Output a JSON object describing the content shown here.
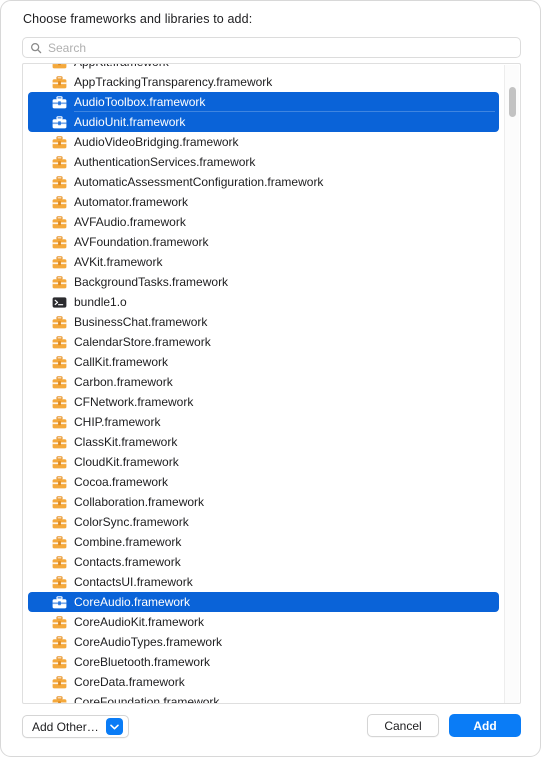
{
  "dialog": {
    "prompt": "Choose frameworks and libraries to add:"
  },
  "search": {
    "icon": "search-icon",
    "placeholder": "Search",
    "value": ""
  },
  "list": {
    "scrollbar": {
      "visible": true
    },
    "items": [
      {
        "label": "AppKit.framework",
        "icon": "framework-icon",
        "selected": false,
        "clipped": true
      },
      {
        "label": "AppTrackingTransparency.framework",
        "icon": "framework-icon",
        "selected": false
      },
      {
        "label": "AudioToolbox.framework",
        "icon": "framework-icon",
        "selected": true
      },
      {
        "label": "AudioUnit.framework",
        "icon": "framework-icon",
        "selected": true
      },
      {
        "label": "AudioVideoBridging.framework",
        "icon": "framework-icon",
        "selected": false
      },
      {
        "label": "AuthenticationServices.framework",
        "icon": "framework-icon",
        "selected": false
      },
      {
        "label": "AutomaticAssessmentConfiguration.framework",
        "icon": "framework-icon",
        "selected": false
      },
      {
        "label": "Automator.framework",
        "icon": "framework-icon",
        "selected": false
      },
      {
        "label": "AVFAudio.framework",
        "icon": "framework-icon",
        "selected": false
      },
      {
        "label": "AVFoundation.framework",
        "icon": "framework-icon",
        "selected": false
      },
      {
        "label": "AVKit.framework",
        "icon": "framework-icon",
        "selected": false
      },
      {
        "label": "BackgroundTasks.framework",
        "icon": "framework-icon",
        "selected": false
      },
      {
        "label": "bundle1.o",
        "icon": "object-file-icon",
        "selected": false
      },
      {
        "label": "BusinessChat.framework",
        "icon": "framework-icon",
        "selected": false
      },
      {
        "label": "CalendarStore.framework",
        "icon": "framework-icon",
        "selected": false
      },
      {
        "label": "CallKit.framework",
        "icon": "framework-icon",
        "selected": false
      },
      {
        "label": "Carbon.framework",
        "icon": "framework-icon",
        "selected": false
      },
      {
        "label": "CFNetwork.framework",
        "icon": "framework-icon",
        "selected": false
      },
      {
        "label": "CHIP.framework",
        "icon": "framework-icon",
        "selected": false
      },
      {
        "label": "ClassKit.framework",
        "icon": "framework-icon",
        "selected": false
      },
      {
        "label": "CloudKit.framework",
        "icon": "framework-icon",
        "selected": false
      },
      {
        "label": "Cocoa.framework",
        "icon": "framework-icon",
        "selected": false
      },
      {
        "label": "Collaboration.framework",
        "icon": "framework-icon",
        "selected": false
      },
      {
        "label": "ColorSync.framework",
        "icon": "framework-icon",
        "selected": false
      },
      {
        "label": "Combine.framework",
        "icon": "framework-icon",
        "selected": false
      },
      {
        "label": "Contacts.framework",
        "icon": "framework-icon",
        "selected": false
      },
      {
        "label": "ContactsUI.framework",
        "icon": "framework-icon",
        "selected": false
      },
      {
        "label": "CoreAudio.framework",
        "icon": "framework-icon",
        "selected": true
      },
      {
        "label": "CoreAudioKit.framework",
        "icon": "framework-icon",
        "selected": false
      },
      {
        "label": "CoreAudioTypes.framework",
        "icon": "framework-icon",
        "selected": false
      },
      {
        "label": "CoreBluetooth.framework",
        "icon": "framework-icon",
        "selected": false
      },
      {
        "label": "CoreData.framework",
        "icon": "framework-icon",
        "selected": false
      },
      {
        "label": "CoreFoundation.framework",
        "icon": "framework-icon",
        "selected": false,
        "clipped": true
      }
    ]
  },
  "footer": {
    "add_other_label": "Add Other…",
    "add_other_chevron": "chevron-down-icon",
    "cancel_label": "Cancel",
    "add_label": "Add"
  },
  "colors": {
    "selection_blue": "#0a63d8",
    "accent_blue": "#0a7cf6",
    "framework_icon_orange": "#f0a03c",
    "text": "#1d1d1f"
  }
}
